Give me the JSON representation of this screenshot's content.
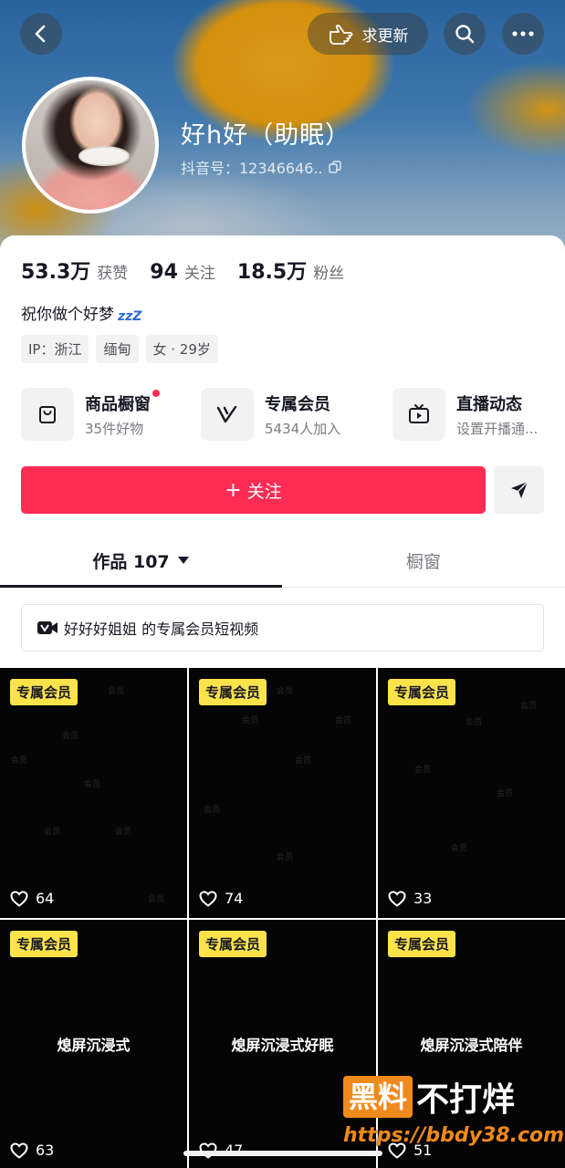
{
  "header": {
    "ask_update_label": "求更新"
  },
  "profile": {
    "nickname": "好h好（助眠）",
    "douyin_id": "抖音号：12346646..",
    "stats": [
      {
        "value": "53.3万",
        "label": "获赞"
      },
      {
        "value": "94",
        "label": "关注"
      },
      {
        "value": "18.5万",
        "label": "粉丝"
      }
    ],
    "signature": "祝你做个好梦",
    "signature_emoji": "zzZ",
    "tags": [
      "IP：浙江",
      "缅甸",
      "女 · 29岁"
    ]
  },
  "features": [
    {
      "title": "商品橱窗",
      "subtitle": "35件好物",
      "icon": "shop-bag-icon"
    },
    {
      "title": "专属会员",
      "subtitle": "5434人加入",
      "icon": "vip-v-icon"
    },
    {
      "title": "直播动态",
      "subtitle": "设置开播通...",
      "icon": "tv-live-icon"
    }
  ],
  "actions": {
    "follow_label": "关注",
    "follow_plus": "+"
  },
  "tabs": {
    "works_label": "作品 107",
    "shop_label": "橱窗"
  },
  "member_banner": "好好好姐姐 的专属会员短视频",
  "videos": [
    {
      "badge": "专属会员",
      "likes": "64",
      "caption": ""
    },
    {
      "badge": "专属会员",
      "likes": "74",
      "caption": ""
    },
    {
      "badge": "专属会员",
      "likes": "33",
      "caption": ""
    },
    {
      "badge": "专属会员",
      "likes": "63",
      "caption": "熄屏沉浸式"
    },
    {
      "badge": "专属会员",
      "likes": "47",
      "caption": "熄屏沉浸式好眠"
    },
    {
      "badge": "专属会员",
      "likes": "51",
      "caption": "熄屏沉浸式陪伴"
    }
  ],
  "tile_watermark": "会员",
  "watermark": {
    "box_text": "黑料",
    "text": "不打烊",
    "url": "https://bbdy38.com"
  },
  "colors": {
    "accent": "#fe2c55",
    "vip_badge": "#fce34a",
    "watermark_orange": "#f08a1c"
  }
}
